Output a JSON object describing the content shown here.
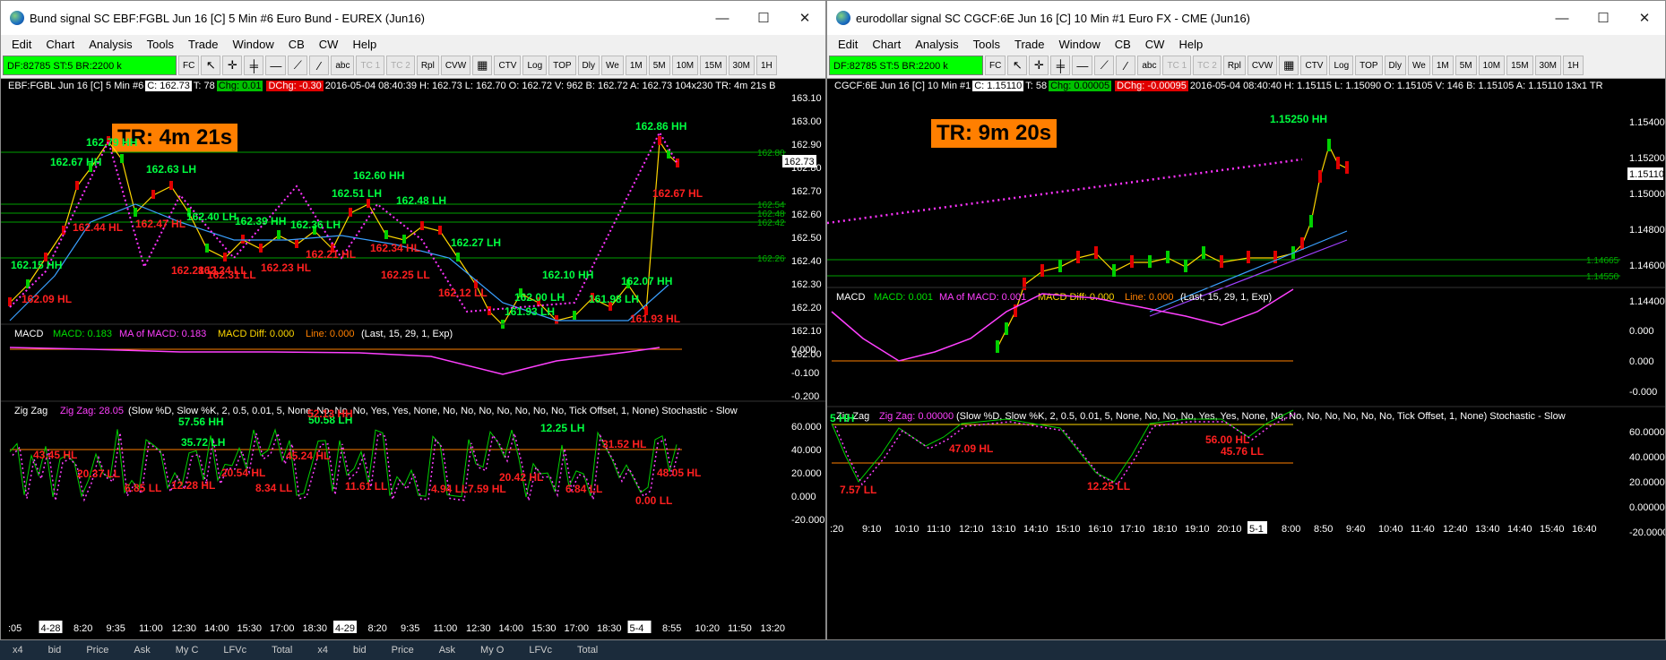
{
  "window1": {
    "title": "Bund signal  SC EBF:FGBL Jun 16 [C]  5 Min  #6  Euro Bund - EUREX (Jun16)",
    "menu": [
      "Edit",
      "Chart",
      "Analysis",
      "Tools",
      "Trade",
      "Window",
      "CB",
      "CW",
      "Help"
    ],
    "status": "DF:82785  ST:5  BR:2200 k",
    "fc": "FC",
    "toolbar": [
      "TC 1",
      "TC 2",
      "Rpl",
      "CVW",
      "CTV",
      "Log",
      "TOP",
      "Dly",
      "We",
      "1M",
      "5M",
      "10M",
      "15M",
      "30M",
      "1H"
    ],
    "header": {
      "symbol": "EBF:FGBL Jun 16 [C]  5 Min  #6",
      "last": "C: 162.73",
      "trades": "T: 78",
      "chg": "Chg: 0.01",
      "dchg": "DChg: -0.30",
      "rest": "2016-05-04 08:40:39 H: 162.73  L: 162.70  O: 162.72  V: 962  B: 162.72  A: 162.73  104x230  TR: 4m 21s B"
    },
    "timer": "TR: 4m 21s",
    "price_ticks": [
      "163.10",
      "163.00",
      "162.90",
      "162.80",
      "162.70",
      "162.60",
      "162.50",
      "162.40",
      "162.30",
      "162.20",
      "162.10",
      "162.00"
    ],
    "price_tag": "162.73",
    "right_levels": [
      "162.80",
      "162.54",
      "162.48",
      "162.42",
      "162.26"
    ],
    "labels_green": [
      {
        "t": "162.79 HH"
      },
      {
        "t": "162.67 HH"
      },
      {
        "t": "162.63 LH"
      },
      {
        "t": "162.60 HH"
      },
      {
        "t": "162.51 LH"
      },
      {
        "t": "162.48 LH"
      },
      {
        "t": "162.40 LH"
      },
      {
        "t": "162.39 HH"
      },
      {
        "t": "162.36 LH"
      },
      {
        "t": "162.27 LH"
      },
      {
        "t": "162.15 HH"
      },
      {
        "t": "162.10 HH"
      },
      {
        "t": "162.07 HH"
      },
      {
        "t": "162.00 LH"
      },
      {
        "t": "161.98 LH"
      },
      {
        "t": "161.93 LH"
      },
      {
        "t": "162.86 HH"
      }
    ],
    "labels_red": [
      {
        "t": "162.44 HL"
      },
      {
        "t": "162.47 HL"
      },
      {
        "t": "162.28 LL"
      },
      {
        "t": "162.31 LL"
      },
      {
        "t": "162.23 HL"
      },
      {
        "t": "162.21 HL"
      },
      {
        "t": "162.34 HL"
      },
      {
        "t": "162.25 LL"
      },
      {
        "t": "162.12 LL"
      },
      {
        "t": "162.09 HL"
      },
      {
        "t": "161.93 HL"
      },
      {
        "t": "162.67 HL"
      },
      {
        "t": "162.24 LL"
      }
    ],
    "macd_label": "MACD",
    "macd_vals": {
      "macd": "MACD: 0.183",
      "ma": "MA of MACD: 0.183",
      "diff": "MACD Diff: 0.000",
      "line": "Line: 0.000",
      "params": "(Last, 15, 29, 1, Exp)"
    },
    "macd_ticks": [
      "0.000",
      "-0.100",
      "-0.200"
    ],
    "zz_label": "Zig Zag",
    "zz_val": "Zig Zag: 28.05",
    "zz_params": "(Slow %D, Slow %K, 2, 0.5, 0.01, 5, None, No, No, No, Yes, Yes, None, No, No, No, No, No, No, No, Tick Offset, 1, None)  Stochastic - Slow",
    "zz_ticks": [
      "60.000",
      "40.000",
      "20.000",
      "0.000",
      "-20.000"
    ],
    "zz_labels": [
      {
        "t": "57.56 HH",
        "c": "g"
      },
      {
        "t": "35.72 LH",
        "c": "g"
      },
      {
        "t": "50.58 LH",
        "c": "g"
      },
      {
        "t": "12.25 LH",
        "c": "g"
      },
      {
        "t": "43.45 HL",
        "c": "r"
      },
      {
        "t": "20.37 LL",
        "c": "r"
      },
      {
        "t": "6.85 LL",
        "c": "r"
      },
      {
        "t": "12.28 HL",
        "c": "r"
      },
      {
        "t": "20.54 HL",
        "c": "r"
      },
      {
        "t": "8.34 LL",
        "c": "r"
      },
      {
        "t": "45.24 HL",
        "c": "r"
      },
      {
        "t": "11.61 LL",
        "c": "r"
      },
      {
        "t": "4.94 LL",
        "c": "r"
      },
      {
        "t": "7.59 HL",
        "c": "r"
      },
      {
        "t": "20.42 HL",
        "c": "r"
      },
      {
        "t": "6.84 LL",
        "c": "r"
      },
      {
        "t": "31.52 HL",
        "c": "r"
      },
      {
        "t": "0.00 LL",
        "c": "r"
      },
      {
        "t": "48.05 HL",
        "c": "r"
      },
      {
        "t": "52.13 HH",
        "c": "r"
      }
    ],
    "time_ticks": [
      ":05",
      "4-28",
      "8:20",
      "9:35",
      "11:00",
      "12:30",
      "14:00",
      "15:30",
      "17:00",
      "18:30",
      "4-29",
      "8:20",
      "9:35",
      "11:00",
      "12:30",
      "14:00",
      "15:30",
      "17:00",
      "18:30",
      "5-4",
      "8:55",
      "10:20",
      "11:50",
      "13:20"
    ]
  },
  "window2": {
    "title": "eurodollar signal  SC CGCF:6E Jun 16 [C]  10 Min  #1  Euro FX - CME (Jun16)",
    "menu": [
      "Edit",
      "Chart",
      "Analysis",
      "Tools",
      "Trade",
      "Window",
      "CB",
      "CW",
      "Help"
    ],
    "status": "DF:82785  ST:5  BR:2200 k",
    "fc": "FC",
    "toolbar": [
      "TC 1",
      "TC 2",
      "Rpl",
      "CVW",
      "CTV",
      "Log",
      "TOP",
      "Dly",
      "We",
      "1M",
      "5M",
      "10M",
      "15M",
      "30M",
      "1H"
    ],
    "header": {
      "symbol": "CGCF:6E Jun 16 [C]  10 Min  #1",
      "last": "C: 1.15110",
      "trades": "T: 58",
      "chg": "Chg: 0.00005",
      "dchg": "DChg: -0.00095",
      "rest": "2016-05-04 08:40:40 H: 1.15115  L: 1.15090  O: 1.15105  V: 146  B: 1.15105  A: 1.15110  13x1 TR"
    },
    "timer": "TR: 9m 20s",
    "price_ticks": [
      "1.15400",
      "1.15200",
      "1.15000",
      "1.14800",
      "1.14600",
      "1.14400"
    ],
    "price_tag": "1.15110",
    "right_levels": [
      "1.14665",
      "1.14550"
    ],
    "labels_green": [
      {
        "t": "1.15250 HH"
      }
    ],
    "macd_label": "MACD",
    "macd_vals": {
      "macd": "MACD: 0.001",
      "ma": "MA of MACD: 0.001",
      "diff": "MACD Diff: 0.000",
      "line": "Line: 0.000",
      "params": "(Last, 15, 29, 1, Exp)"
    },
    "macd_ticks": [
      "0.000",
      "0.000",
      "-0.000"
    ],
    "zz_label": "Zig Zag",
    "zz_val": "Zig Zag: 0.00000",
    "zz_params": "(Slow %D, Slow %K, 2, 0.5, 0.01, 5, None, No, No, No, Yes, Yes, None, No, No, No, No, No, No, No, Tick Offset, 1, None)  Stochastic - Slow",
    "zz_ticks": [
      "60.00000",
      "40.00000",
      "20.00000",
      "0.00000",
      "-20.00000"
    ],
    "zz_labels": [
      {
        "t": "7.57 LL",
        "c": "r"
      },
      {
        "t": "47.09 HL",
        "c": "r"
      },
      {
        "t": "12.25 LL",
        "c": "r"
      },
      {
        "t": "56.00 HL",
        "c": "r"
      },
      {
        "t": "45.76 LL",
        "c": "r"
      },
      {
        "t": "5 HH",
        "c": "g"
      }
    ],
    "time_ticks": [
      ":20",
      "9:10",
      "10:10",
      "11:10",
      "12:10",
      "13:10",
      "14:10",
      "15:10",
      "16:10",
      "17:10",
      "18:10",
      "19:10",
      "20:10",
      "5-1",
      "8:00",
      "8:50",
      "9:40",
      "10:40",
      "11:40",
      "12:40",
      "13:40",
      "14:40",
      "15:40",
      "16:40"
    ]
  },
  "taskbar": [
    "x4",
    "bid",
    "Price",
    "Ask",
    "My C",
    "LFVc",
    "Total",
    "x4",
    "bid",
    "Price",
    "Ask",
    "My O",
    "LFVc",
    "Total"
  ]
}
